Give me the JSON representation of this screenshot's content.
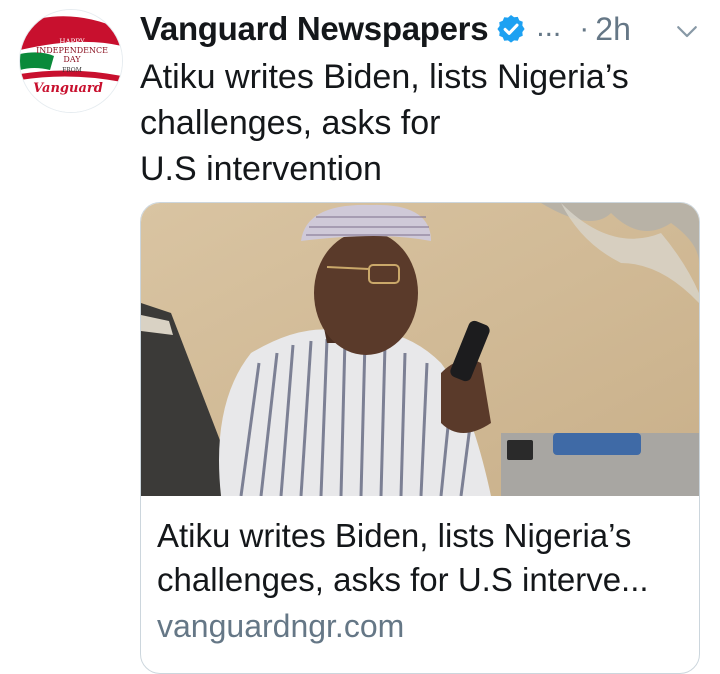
{
  "tweet": {
    "display_name": "Vanguard Newspapers",
    "overflow": "...",
    "separator": "·",
    "time": "2h",
    "text_lines": [
      "Atiku writes Biden, lists Nigeria’s",
      "challenges, asks for",
      "U.S intervention"
    ]
  },
  "avatar": {
    "line1": "HAPPY",
    "line2": "INDEPENDENCE",
    "line3": "DAY",
    "line4": "FROM",
    "brand": "Vanguard"
  },
  "card": {
    "title_lines": [
      "Atiku writes Biden, lists Nigeria’s",
      "challenges, asks for U.S interve..."
    ],
    "domain": "vanguardngr.com"
  },
  "colors": {
    "text": "#14171a",
    "secondary": "#657786",
    "verified": "#1da1f2",
    "border": "#ccd6dd",
    "avatar_red": "#c8102e",
    "avatar_green": "#0a8a3a"
  },
  "icons": {
    "verified": "verified-badge-icon",
    "chevron": "chevron-down-icon"
  }
}
